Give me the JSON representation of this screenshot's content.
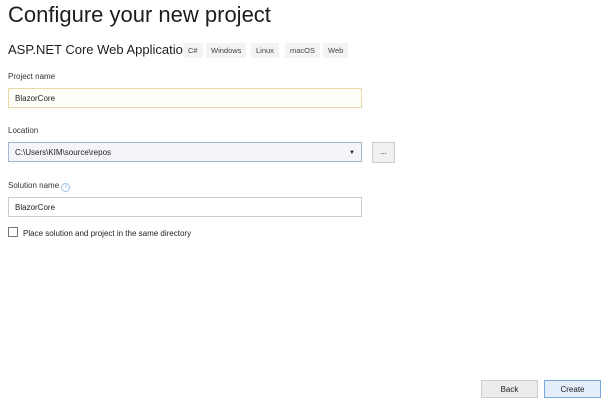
{
  "title": "Configure your new project",
  "template": {
    "name": "ASP.NET Core Web Application",
    "tags": [
      "C#",
      "Windows",
      "Linux",
      "macOS",
      "Web"
    ]
  },
  "project_name": {
    "label": "Project name",
    "value": "BlazorCore"
  },
  "location": {
    "label": "Location",
    "value": "C:\\Users\\KIM\\source\\repos",
    "browse_label": "..."
  },
  "solution_name": {
    "label": "Solution name",
    "value": "BlazorCore"
  },
  "same_dir": {
    "label": "Place solution and project in the same directory",
    "checked": false
  },
  "buttons": {
    "back": "Back",
    "create": "Create"
  }
}
